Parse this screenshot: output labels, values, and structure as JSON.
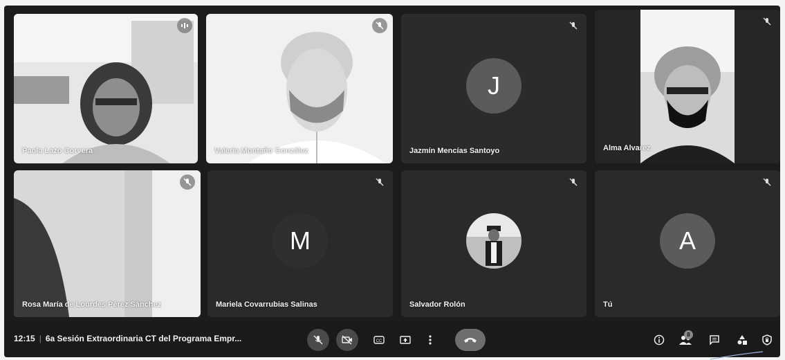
{
  "participants": [
    {
      "name": "Paola Lazo Corvera",
      "mic": "speaking-icon"
    },
    {
      "name": "Valeria Montaño González",
      "mic": "mic-off-icon"
    },
    {
      "name": "Jazmín Mencías Santoyo",
      "mic": "mic-off-icon",
      "initial": "J"
    },
    {
      "name": "Alma Alvarez",
      "mic": "mic-off-icon"
    },
    {
      "name": "Rosa María de Lourdes Pérez Sánchez",
      "mic": "mic-off-icon"
    },
    {
      "name": "Mariela Covarrubias Salinas",
      "mic": "mic-off-icon",
      "initial": "M"
    },
    {
      "name": "Salvador Rolón",
      "mic": "mic-off-icon"
    },
    {
      "name": "Tú",
      "mic": "mic-off-icon",
      "initial": "A"
    }
  ],
  "toolbar": {
    "time": "12:15",
    "meeting_title": "6a Sesión Extraordinaria CT del Programa Empr...",
    "controls": [
      "mic-off-icon",
      "camera-off-icon",
      "captions-icon",
      "present-icon",
      "more-icon",
      "hang-up-icon"
    ],
    "right_icons": [
      "info-icon",
      "people-icon",
      "chat-icon",
      "activities-icon",
      "host-controls-icon"
    ],
    "people_count": "8"
  },
  "colors": {
    "background": "#1c1c1c",
    "tile": "#2a2a2a",
    "avatar": "#5b5b5b",
    "toolbar_button": "#4a4a4a",
    "hangup": "#6e6e6e"
  }
}
